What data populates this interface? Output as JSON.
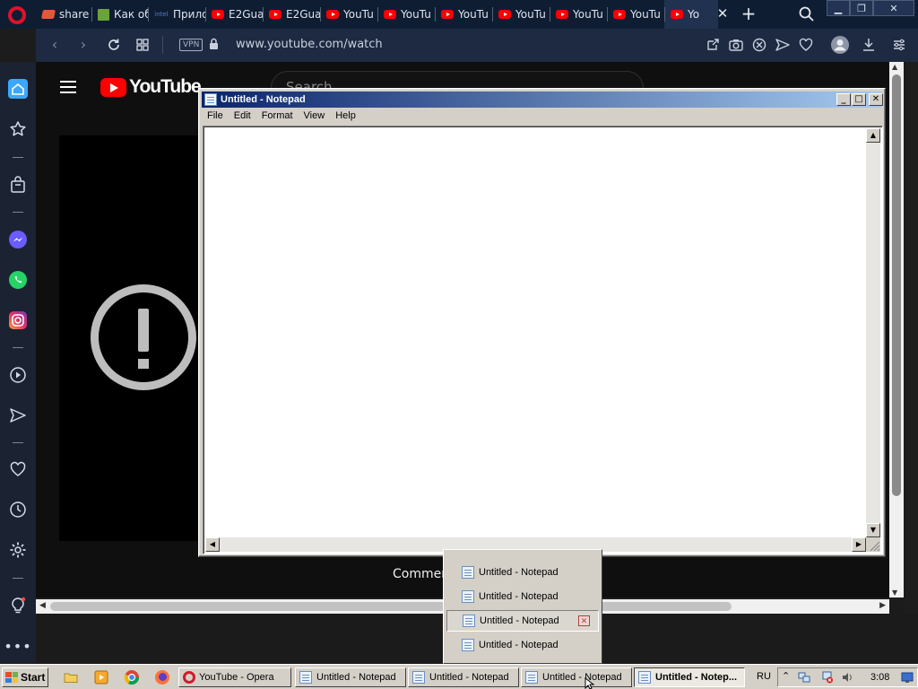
{
  "browser": {
    "tabs": [
      {
        "label": "share",
        "icon": "share-icon",
        "width": 62
      },
      {
        "label": "Как об",
        "icon": "minecraft-icon",
        "width": 63
      },
      {
        "label": "Прило",
        "icon": "intel-icon",
        "width": 64
      },
      {
        "label": "E2Gua",
        "icon": "youtube-icon",
        "width": 64
      },
      {
        "label": "E2Gua",
        "icon": "youtube-icon",
        "width": 64
      },
      {
        "label": "YouTu",
        "icon": "youtube-icon",
        "width": 64
      },
      {
        "label": "YouTu",
        "icon": "youtube-icon",
        "width": 64
      },
      {
        "label": "YouTu",
        "icon": "youtube-icon",
        "width": 64
      },
      {
        "label": "YouTu",
        "icon": "youtube-icon",
        "width": 64
      },
      {
        "label": "YouTu",
        "icon": "youtube-icon",
        "width": 64
      },
      {
        "label": "YouTu",
        "icon": "youtube-icon",
        "width": 64
      },
      {
        "label": "Yo",
        "icon": "youtube-icon",
        "width": 60,
        "active": true
      }
    ],
    "vpn_label": "VPN",
    "url": "www.youtube.com/watch"
  },
  "youtube": {
    "logo_text": "YouTube",
    "search_placeholder": "Search",
    "comments_label": "Commen"
  },
  "notepad": {
    "title": "Untitled - Notepad",
    "menu": [
      "File",
      "Edit",
      "Format",
      "View",
      "Help"
    ]
  },
  "group_menu": {
    "items": [
      "Untitled - Notepad",
      "Untitled - Notepad",
      "Untitled - Notepad",
      "Untitled - Notepad"
    ],
    "hover_index": 2
  },
  "taskbar": {
    "start_label": "Start",
    "buttons": [
      {
        "label": "YouTube - Opera",
        "icon": "opera-icon"
      },
      {
        "label": "Untitled - Notepad",
        "icon": "notepad-icon"
      },
      {
        "label": "Untitled - Notepad",
        "icon": "notepad-icon"
      },
      {
        "label": "Untitled - Notepad",
        "icon": "notepad-icon"
      },
      {
        "label": "Untitled - Notep...",
        "icon": "notepad-icon",
        "active": true
      }
    ],
    "language": "RU",
    "clock": "3:08"
  },
  "colors": {
    "opera_red": "#e0112b",
    "youtube_red": "#ff0000",
    "tab_bar": "#0f1d33",
    "title_gradient_start": "#0a246a",
    "title_gradient_end": "#a6caf0"
  }
}
